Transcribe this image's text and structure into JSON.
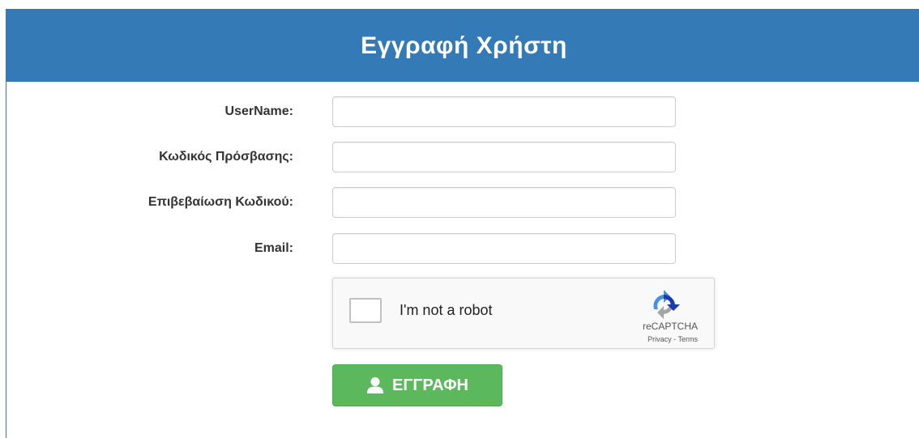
{
  "header": {
    "title": "Εγγραφή Χρήστη"
  },
  "form": {
    "fields": [
      {
        "label": "UserName:",
        "value": "",
        "placeholder": ""
      },
      {
        "label": "Κωδικός Πρόσβασης:",
        "value": "",
        "placeholder": ""
      },
      {
        "label": "Επιβεβαίωση Κωδικού:",
        "value": "",
        "placeholder": ""
      },
      {
        "label": "Email:",
        "value": "",
        "placeholder": ""
      }
    ]
  },
  "recaptcha": {
    "label": "I'm not a robot",
    "brand": "reCAPTCHA",
    "privacy": "Privacy",
    "separator": " - ",
    "terms": "Terms",
    "checked": false
  },
  "submit": {
    "label": "ΕΓΓΡΑΦΗ",
    "icon": "user-icon"
  },
  "colors": {
    "header_bg": "#337ab7",
    "button_bg": "#5cb85c",
    "label_text": "#333333"
  }
}
